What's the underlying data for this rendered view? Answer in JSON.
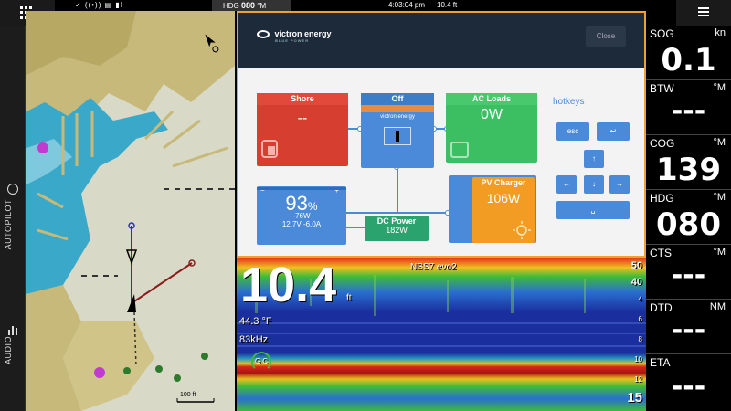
{
  "topbar": {
    "status_text": "✓ ((•)) ▤ ▮I",
    "hdg_label": "HDG",
    "hdg_value": "080",
    "hdg_unit": "°M",
    "time": "4:03:04 pm",
    "depth": "10.4 ft"
  },
  "sidebar": {
    "autopilot_label": "AUTOPILOT",
    "audio_label": "AUDIO"
  },
  "chart": {
    "scale_label": "100 ft",
    "icons": [
      "mooring-icon",
      "vessel-icon"
    ]
  },
  "victron": {
    "brand": "victron energy",
    "brand_sub": "BLUE POWER",
    "close_label": "Close",
    "shore": {
      "label": "Shore",
      "value": "--"
    },
    "inverter": {
      "label": "Off",
      "brand": "victron energy"
    },
    "loads": {
      "label": "AC Loads",
      "value": "0W"
    },
    "battery": {
      "value": "93",
      "unit": "%",
      "power": "-76W",
      "voltage": "12.7V",
      "current": "-6.0A"
    },
    "dcpower": {
      "label": "DC Power",
      "value": "182W"
    },
    "pv": {
      "label": "PV Charger",
      "value": "106W"
    },
    "hotkeys": {
      "title": "hotkeys",
      "esc": "esc",
      "enter": "↩",
      "up": "↑",
      "left": "←",
      "down": "↓",
      "right": "→",
      "space": "␣"
    }
  },
  "sonar": {
    "depth_value": "10.4",
    "depth_unit": "ft",
    "temperature": "44.3 °F",
    "frequency": "83kHz",
    "gain_label": "G",
    "color_label": "C",
    "source": "NSS7 evo2",
    "scale": [
      "50",
      "40",
      "4",
      "6",
      "8",
      "10",
      "12",
      "15"
    ]
  },
  "datapanel": [
    {
      "key": "SOG",
      "unit": "kn",
      "value": "0.1"
    },
    {
      "key": "BTW",
      "unit": "°M",
      "value": "---"
    },
    {
      "key": "COG",
      "unit": "°M",
      "value": "139"
    },
    {
      "key": "HDG",
      "unit": "°M",
      "value": "080"
    },
    {
      "key": "CTS",
      "unit": "°M",
      "value": "---"
    },
    {
      "key": "DTD",
      "unit": "NM",
      "value": "---"
    },
    {
      "key": "ETA",
      "unit": "",
      "value": "---"
    }
  ]
}
